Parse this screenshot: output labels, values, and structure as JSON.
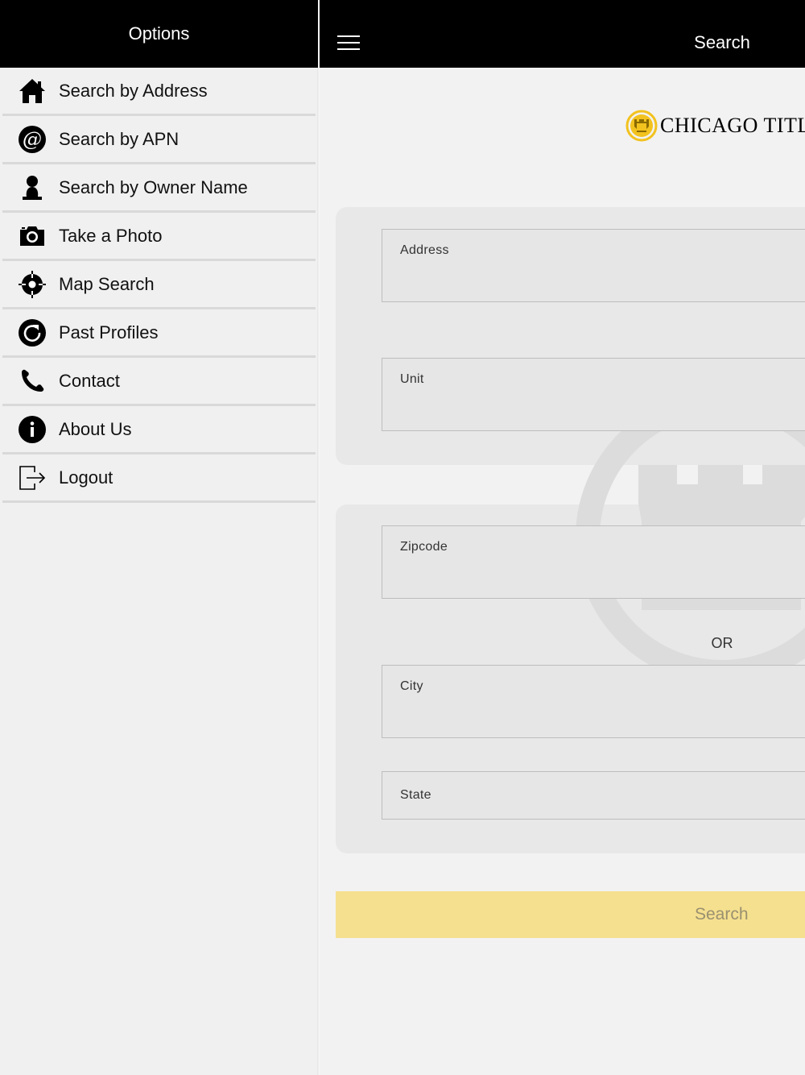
{
  "sidebar": {
    "title": "Options",
    "items": [
      {
        "label": "Search by Address",
        "icon": "home-icon"
      },
      {
        "label": "Search by APN",
        "icon": "at-sign-icon"
      },
      {
        "label": "Search by Owner Name",
        "icon": "person-icon"
      },
      {
        "label": "Take a Photo",
        "icon": "camera-icon"
      },
      {
        "label": "Map Search",
        "icon": "crosshair-icon"
      },
      {
        "label": "Past Profiles",
        "icon": "refresh-icon"
      },
      {
        "label": "Contact",
        "icon": "phone-icon"
      },
      {
        "label": "About Us",
        "icon": "info-icon"
      },
      {
        "label": "Logout",
        "icon": "logout-icon"
      }
    ]
  },
  "header": {
    "title": "Search",
    "menu_icon": "hamburger-icon"
  },
  "logo": {
    "text": "CHICAGO TITL"
  },
  "form": {
    "address_label": "Address",
    "unit_label": "Unit",
    "zipcode_label": "Zipcode",
    "or_text": "OR",
    "city_label": "City",
    "state_label": "State",
    "submit_label": "Search"
  },
  "colors": {
    "header_bg": "#000000",
    "accent_yellow": "#f5e08f",
    "logo_gold": "#f2c21f"
  }
}
